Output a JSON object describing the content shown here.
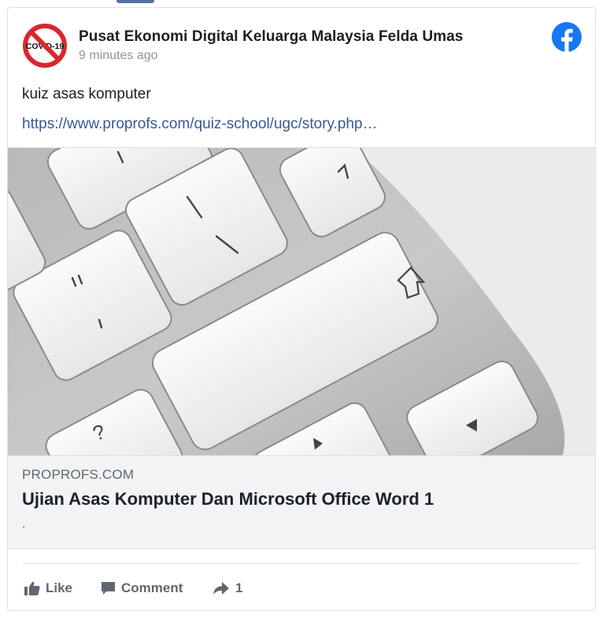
{
  "post": {
    "page_name": "Pusat Ekonomi Digital Keluarga Malaysia Felda Umas",
    "timestamp": "9 minutes ago",
    "text": "kuiz asas komputer",
    "link_url": "https://www.proprofs.com/quiz-school/ugc/story.php…",
    "avatar_label": "COVID-19"
  },
  "link_preview": {
    "domain": "PROPROFS.COM",
    "title": "Ujian Asas Komputer Dan Microsoft Office Word 1",
    "description": "."
  },
  "actions": {
    "like_label": "Like",
    "comment_label": "Comment",
    "share_count": "1"
  },
  "icons": {
    "avatar": "no-covid-icon",
    "brand": "facebook-icon",
    "like": "thumbs-up-icon",
    "comment": "comment-bubble-icon",
    "share": "share-arrow-icon"
  },
  "colors": {
    "link": "#385898",
    "facebook_blue": "#1877f2",
    "muted_text": "#606770",
    "preview_bg": "#f2f3f5"
  }
}
